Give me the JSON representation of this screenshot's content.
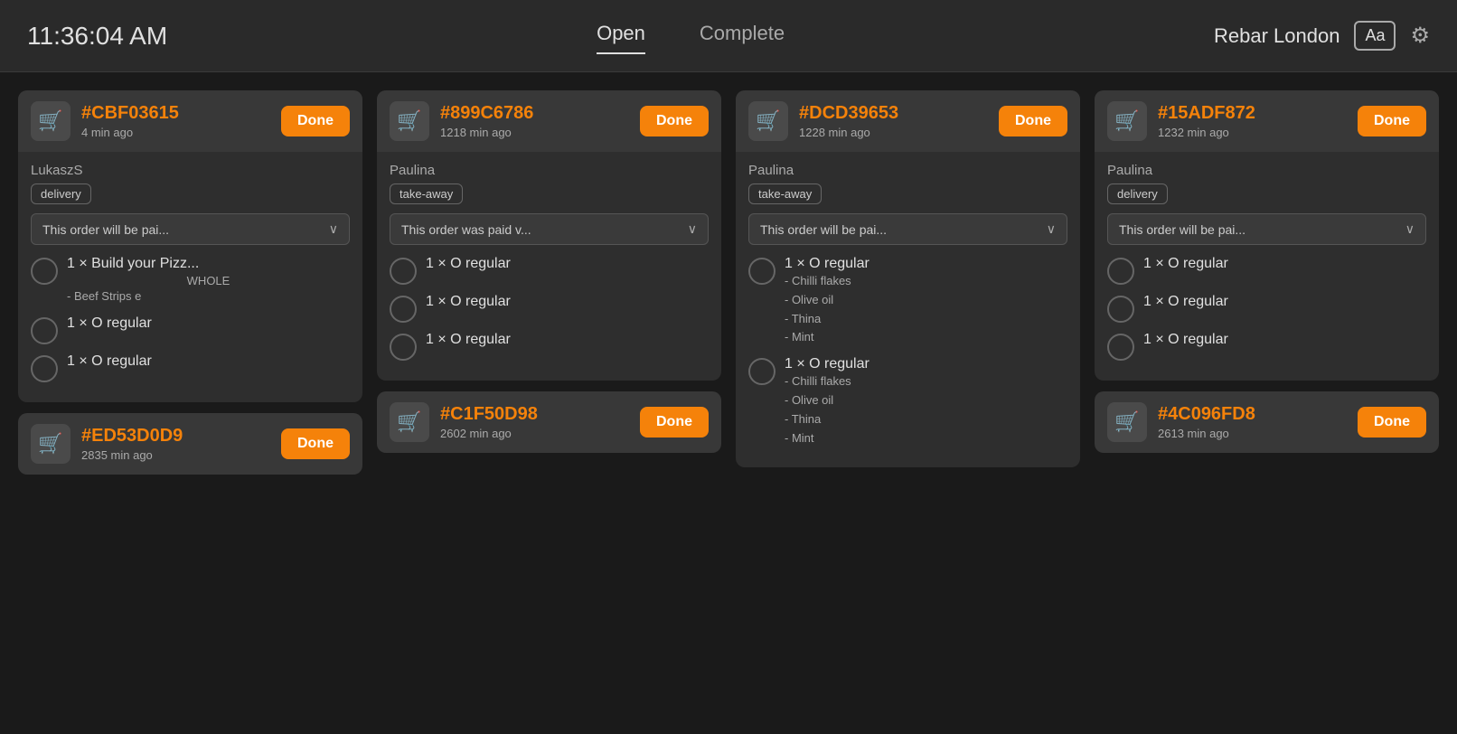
{
  "topbar": {
    "time": "11:36:04 AM",
    "tabs": [
      {
        "label": "Open",
        "active": true
      },
      {
        "label": "Complete",
        "active": false
      }
    ],
    "venue": "Rebar London",
    "font_btn": "Aa",
    "gear_icon": "⚙"
  },
  "columns": [
    {
      "cards": [
        {
          "id": "#CBF03615",
          "time": "4 min ago",
          "done_label": "Done",
          "customer": "LukaszS",
          "order_type": "delivery",
          "payment": "This order will be pai...",
          "items": [
            {
              "qty_name": "1 × Build your Pizz...",
              "sub1": "WHOLE",
              "sub2": "- Beef Strips e",
              "modifiers": []
            },
            {
              "qty_name": "1 × O regular",
              "modifiers": []
            },
            {
              "qty_name": "1 × O regular",
              "modifiers": []
            }
          ]
        },
        {
          "id": "#ED53D0D9",
          "time": "2835 min ago",
          "done_label": "Done",
          "customer": "",
          "order_type": "",
          "payment": "",
          "items": []
        }
      ]
    },
    {
      "cards": [
        {
          "id": "#899C6786",
          "time": "1218 min ago",
          "done_label": "Done",
          "customer": "Paulina",
          "order_type": "take-away",
          "payment": "This order was paid v...",
          "items": [
            {
              "qty_name": "1 × O regular",
              "modifiers": []
            },
            {
              "qty_name": "1 × O regular",
              "modifiers": []
            },
            {
              "qty_name": "1 × O regular",
              "modifiers": []
            }
          ]
        },
        {
          "id": "#C1F50D98",
          "time": "2602 min ago",
          "done_label": "Done",
          "customer": "",
          "order_type": "",
          "payment": "",
          "items": []
        }
      ]
    },
    {
      "cards": [
        {
          "id": "#DCD39653",
          "time": "1228 min ago",
          "done_label": "Done",
          "customer": "Paulina",
          "order_type": "take-away",
          "payment": "This order will be pai...",
          "items": [
            {
              "qty_name": "1 × O regular",
              "modifiers": [
                "- Chilli flakes",
                "- Olive oil",
                "- Thina",
                "- Mint"
              ]
            },
            {
              "qty_name": "1 × O regular",
              "modifiers": [
                "- Chilli flakes",
                "- Olive oil",
                "- Thina",
                "- Mint"
              ]
            }
          ]
        }
      ]
    },
    {
      "cards": [
        {
          "id": "#15ADF872",
          "time": "1232 min ago",
          "done_label": "Done",
          "customer": "Paulina",
          "order_type": "delivery",
          "payment": "This order will be pai...",
          "items": [
            {
              "qty_name": "1 × O regular",
              "modifiers": []
            },
            {
              "qty_name": "1 × O regular",
              "modifiers": []
            },
            {
              "qty_name": "1 × O regular",
              "modifiers": []
            }
          ]
        },
        {
          "id": "#4C096FD8",
          "time": "2613 min ago",
          "done_label": "Done",
          "customer": "",
          "order_type": "",
          "payment": "",
          "items": []
        }
      ]
    }
  ]
}
